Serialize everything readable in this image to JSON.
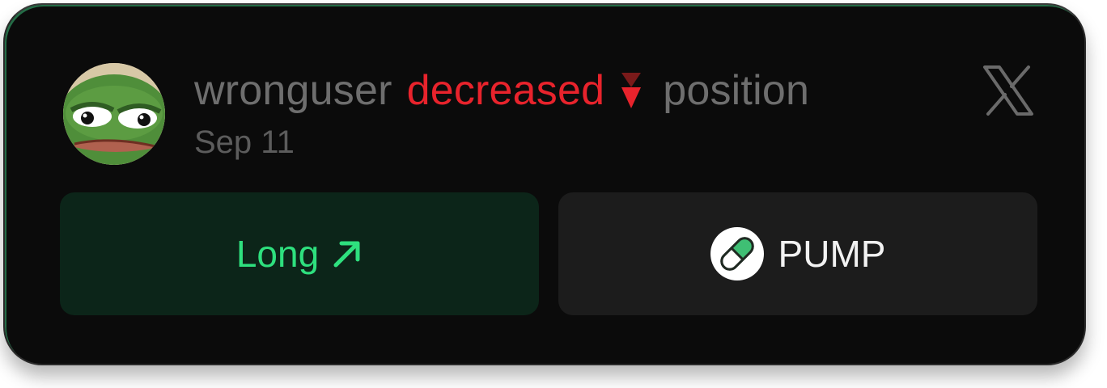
{
  "notification": {
    "username": "wronguser",
    "action": "decreased",
    "action_icon": "down-arrow-icon",
    "trailing_word": "position",
    "date": "Sep 11",
    "social_icon": "x-logo-icon"
  },
  "actions": {
    "long_label": "Long",
    "long_icon": "arrow-up-right-icon",
    "token_label": "PUMP",
    "token_icon": "pill-icon"
  },
  "colors": {
    "card_bg": "#0b0b0b",
    "accent_green": "#2ee07e",
    "long_bg": "#0c2519",
    "decrease_red": "#e8232c",
    "muted_text": "#6e6e6e",
    "token_bg": "#1c1c1c"
  }
}
